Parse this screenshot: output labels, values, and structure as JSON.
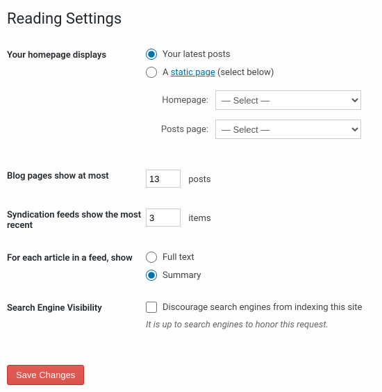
{
  "page_title": "Reading Settings",
  "homepage": {
    "label": "Your homepage displays",
    "opt_latest": "Your latest posts",
    "opt_static_prefix": "A ",
    "opt_static_link": "static page",
    "opt_static_suffix": " (select below)",
    "homepage_label": "Homepage:",
    "posts_page_label": "Posts page:",
    "select_placeholder": "— Select —"
  },
  "blog_pages": {
    "label": "Blog pages show at most",
    "value": "13",
    "unit": "posts"
  },
  "syndication": {
    "label": "Syndication feeds show the most recent",
    "value": "3",
    "unit": "items"
  },
  "feed_article": {
    "label": "For each article in a feed, show",
    "opt_full": "Full text",
    "opt_summary": "Summary"
  },
  "search_visibility": {
    "label": "Search Engine Visibility",
    "checkbox_label": "Discourage search engines from indexing this site",
    "description": "It is up to search engines to honor this request."
  },
  "submit_label": "Save Changes"
}
